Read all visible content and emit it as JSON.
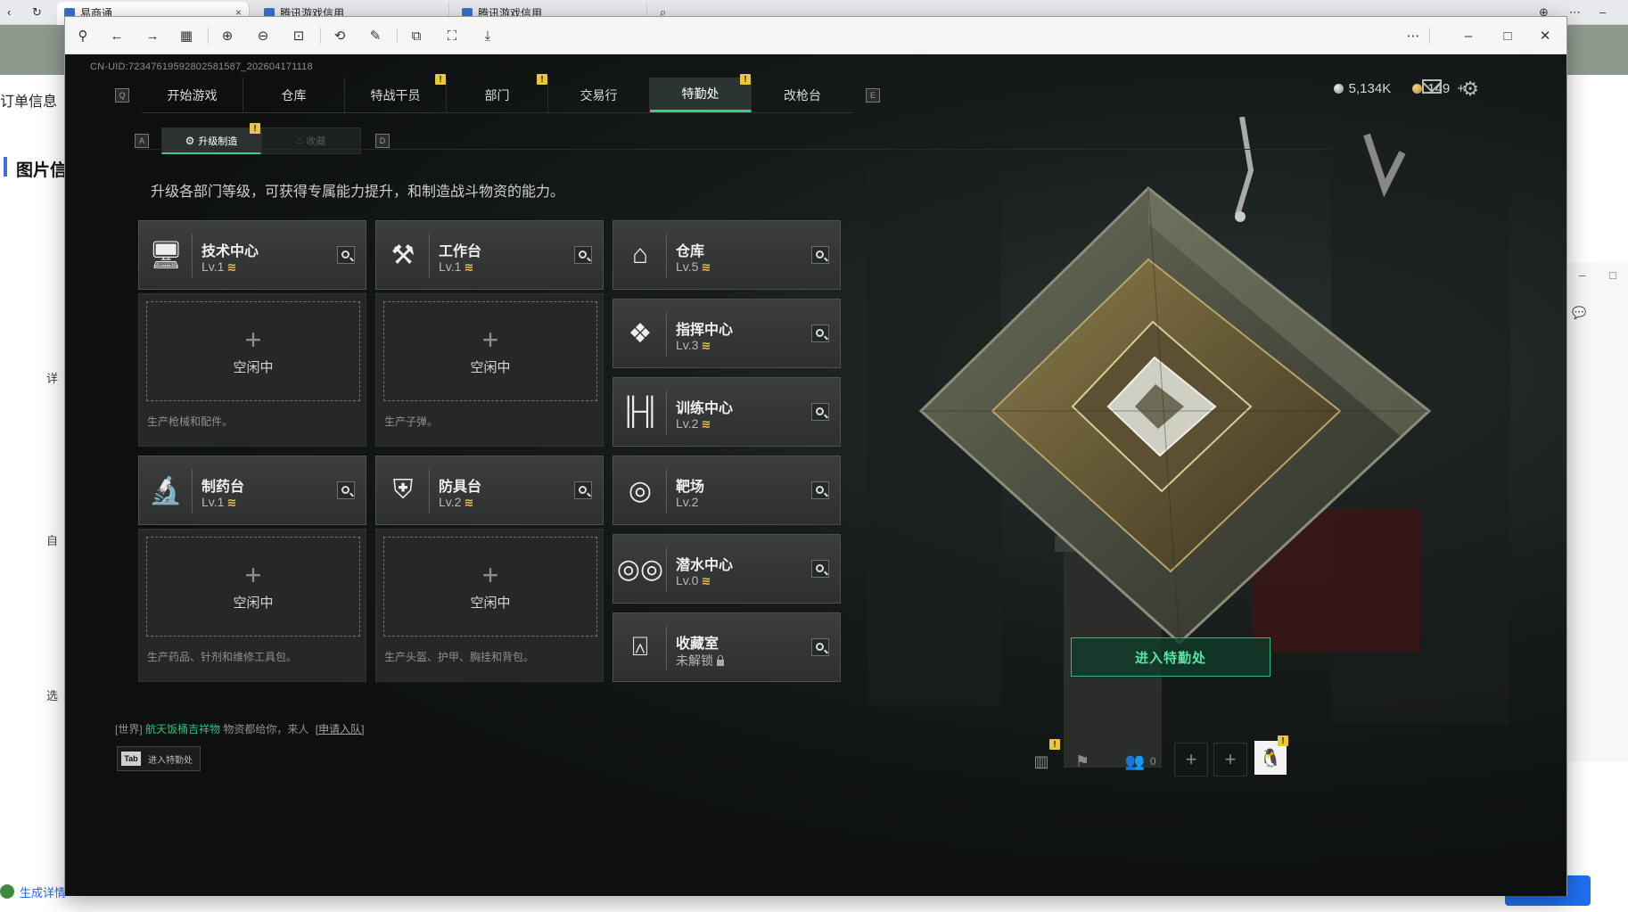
{
  "browser": {
    "tabs": [
      {
        "label": "易商通",
        "close": "×"
      },
      {
        "label": "腾讯游戏信用"
      },
      {
        "label": "腾讯游戏信用"
      }
    ]
  },
  "background_page": {
    "left_title": "订单信息",
    "section_title": "图片信",
    "labels": [
      "详",
      "自",
      "选"
    ],
    "bottom_left": "生成详情"
  },
  "game": {
    "uid": "CN-UID:7234761959280258158​7_202604171118",
    "nav_keys": {
      "left": "Q",
      "right": "E"
    },
    "nav_tabs": [
      {
        "label": "开始游戏",
        "badge": ""
      },
      {
        "label": "仓库",
        "badge": ""
      },
      {
        "label": "特战干员",
        "badge": "!"
      },
      {
        "label": "部门",
        "badge": "!"
      },
      {
        "label": "交易行",
        "badge": ""
      },
      {
        "label": "特勤处",
        "badge": "!",
        "active": true
      },
      {
        "label": "改枪台",
        "badge": ""
      }
    ],
    "subnav_keys": {
      "left": "A",
      "right": "D"
    },
    "subtabs": [
      {
        "label": "升级制造",
        "badge": "!"
      },
      {
        "label": "收藏"
      }
    ],
    "resources": {
      "silver": "5,134K",
      "gold": "149",
      "plus": "+"
    },
    "description": "升级各部门等级，可获得专属能力提升，和制造战斗物资的能力。",
    "modules": {
      "tech_center": {
        "name": "技术中心",
        "level": "Lv.1",
        "upgradable": true
      },
      "workbench": {
        "name": "工作台",
        "level": "Lv.1",
        "upgradable": true
      },
      "warehouse": {
        "name": "仓库",
        "level": "Lv.5",
        "upgradable": true
      },
      "command_center": {
        "name": "指挥中心",
        "level": "Lv.3",
        "upgradable": true
      },
      "training_center": {
        "name": "训练中心",
        "level": "Lv.2",
        "upgradable": true
      },
      "pharmacy": {
        "name": "制药台",
        "level": "Lv.1",
        "upgradable": true
      },
      "armor_bench": {
        "name": "防具台",
        "level": "Lv.2",
        "upgradable": true
      },
      "shooting_range": {
        "name": "靶场",
        "level": "Lv.2",
        "upgradable": false
      },
      "diving_center": {
        "name": "潜水中心",
        "level": "Lv.0",
        "upgradable": true
      },
      "collection_room": {
        "name": "收藏室",
        "level": "未解锁",
        "locked": true
      }
    },
    "upgrade_glyph": "≋",
    "slots": {
      "idle_label": "空闲中",
      "plus": "+",
      "tech_desc": "生产枪械和配件。",
      "workbench_desc": "生产子弹。",
      "pharmacy_desc": "生产药品、针剂和维修工具包。",
      "armor_desc": "生产头盔、护甲、胸挂和背包。"
    },
    "enter_button": "进入特勤处",
    "chat": {
      "channel": "[世界]",
      "name": "航天饭桶吉祥物",
      "message": "物资都给你，来人",
      "join": "[申请入队]"
    },
    "tab_hint": {
      "key": "Tab",
      "label": "进入特勤处"
    },
    "bottom_counts": {
      "friends": "0"
    }
  },
  "colors": {
    "accent": "#3fc98a",
    "warning": "#e9c542",
    "upgrade": "#e8c04a"
  }
}
